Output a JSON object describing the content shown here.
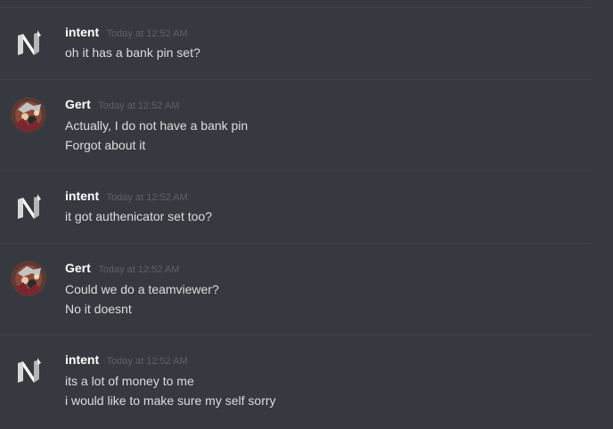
{
  "messages": [
    {
      "author": "intent",
      "timestamp": "Today at 12:52 AM",
      "avatar_icon": "n-logo-avatar",
      "lines": [
        "oh it has a bank pin set?"
      ]
    },
    {
      "author": "Gert",
      "timestamp": "Today at 12:52 AM",
      "avatar_icon": "character-portrait-avatar",
      "lines": [
        "Actually, I do not have a bank pin",
        "Forgot about it"
      ]
    },
    {
      "author": "intent",
      "timestamp": "Today at 12:52 AM",
      "avatar_icon": "n-logo-avatar",
      "lines": [
        "it got authenicator set too?"
      ]
    },
    {
      "author": "Gert",
      "timestamp": "Today at 12:52 AM",
      "avatar_icon": "character-portrait-avatar",
      "lines": [
        "Could we do a teamviewer?",
        "No it doesnt"
      ]
    },
    {
      "author": "intent",
      "timestamp": "Today at 12:52 AM",
      "avatar_icon": "n-logo-avatar",
      "lines": [
        "its a lot of money to me",
        "i would like to make sure my self sorry"
      ]
    }
  ],
  "colors": {
    "background": "#36393f",
    "divider": "#40434a",
    "username": "#ffffff",
    "timestamp": "#5e6168",
    "message_text": "#dcddde"
  }
}
